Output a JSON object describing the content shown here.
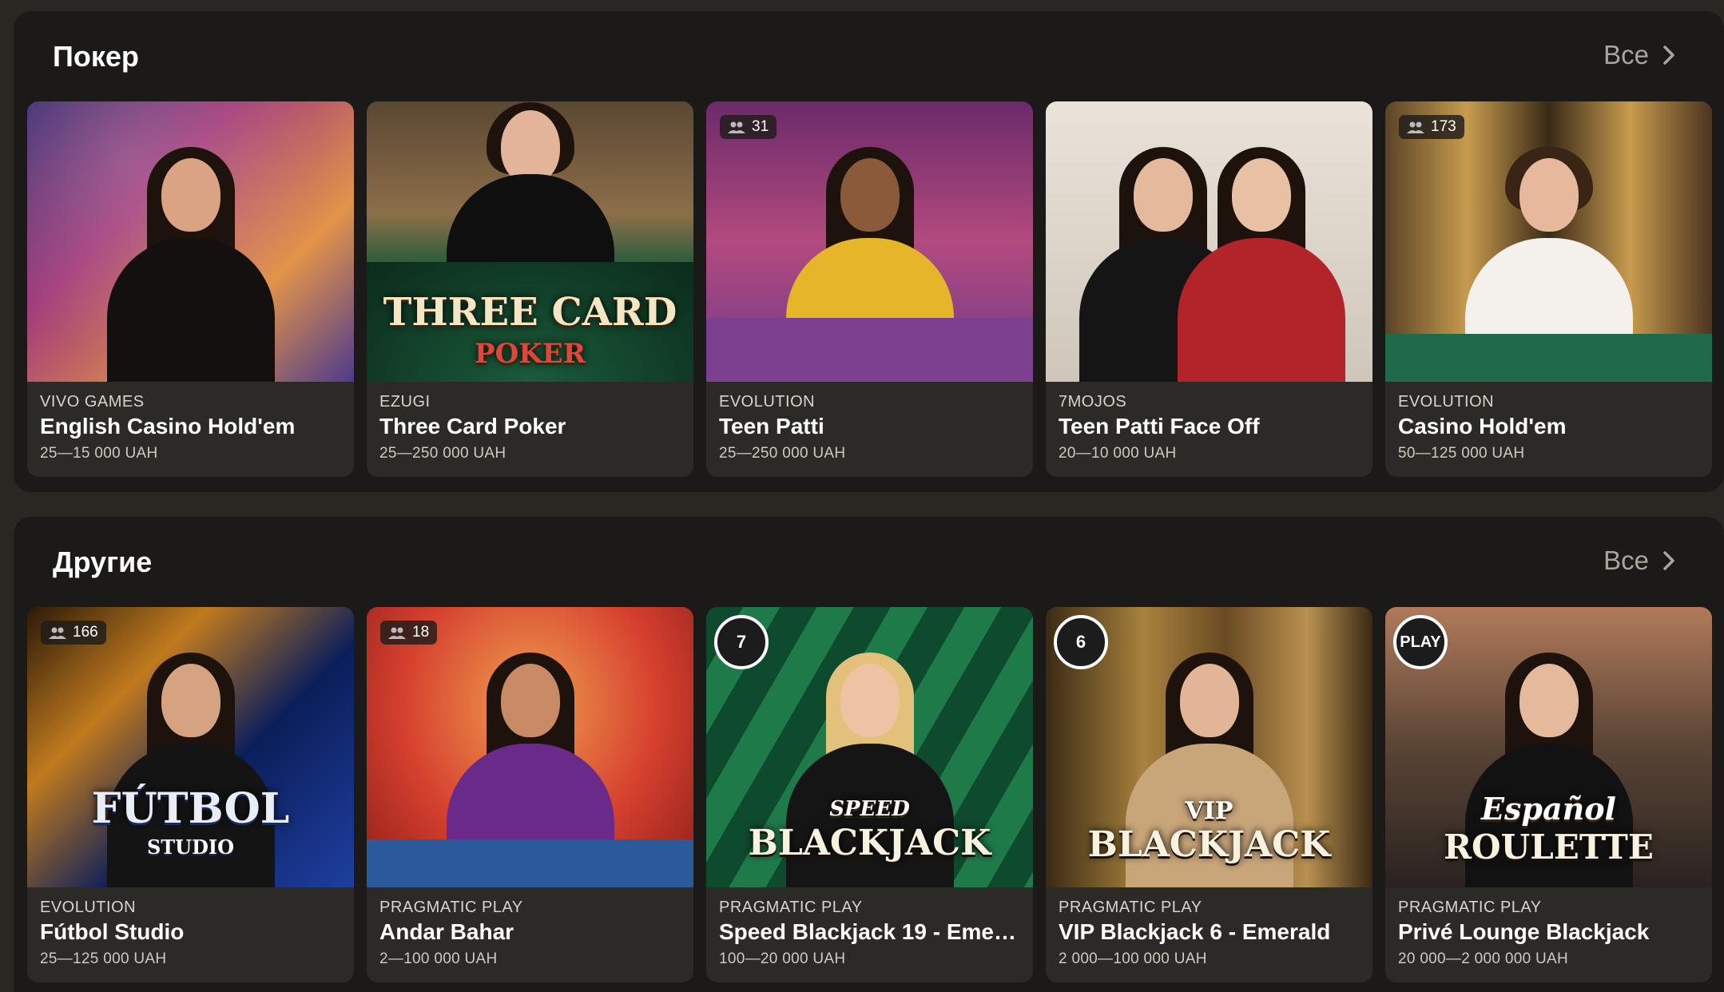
{
  "sections": [
    {
      "title": "Покер",
      "all_label": "Все",
      "cards": [
        {
          "provider": "VIVO GAMES",
          "name": "English Casino Hold'em",
          "limits": "25—15 000 UAH",
          "players": ""
        },
        {
          "provider": "EZUGI",
          "name": "Three Card Poker",
          "limits": "25—250 000 UAH",
          "players": "",
          "logo_line1": "THREE CARD",
          "logo_line2": "POKER"
        },
        {
          "provider": "EVOLUTION",
          "name": "Teen Patti",
          "limits": "25—250 000 UAH",
          "players": "31"
        },
        {
          "provider": "7MOJOS",
          "name": "Teen Patti Face Off",
          "limits": "20—10 000 UAH",
          "players": ""
        },
        {
          "provider": "EVOLUTION",
          "name": "Casino Hold'em",
          "limits": "50—125 000 UAH",
          "players": "173"
        }
      ]
    },
    {
      "title": "Другие",
      "all_label": "Все",
      "cards": [
        {
          "provider": "EVOLUTION",
          "name": "Fútbol Studio",
          "limits": "25—125 000 UAH",
          "players": "166",
          "logo_line1": "FÚTBOL",
          "logo_line2": "STUDIO"
        },
        {
          "provider": "PRAGMATIC PLAY",
          "name": "Andar Bahar",
          "limits": "2—100 000 UAH",
          "players": "18"
        },
        {
          "provider": "PRAGMATIC PLAY",
          "name": "Speed Blackjack 19 - Eme…",
          "limits": "100—20 000 UAH",
          "players": "7",
          "logo_line1": "SPEED",
          "logo_line2": "BLACKJACK"
        },
        {
          "provider": "PRAGMATIC PLAY",
          "name": "VIP Blackjack 6 - Emerald",
          "limits": "2 000—100 000 UAH",
          "players": "6",
          "logo_line1": "VIP",
          "logo_line2": "BLACKJACK"
        },
        {
          "provider": "PRAGMATIC PLAY",
          "name": "Privé Lounge Blackjack",
          "limits": "20 000—2 000 000 UAH",
          "players": "",
          "badge_text": "PLAY",
          "logo_line1": "Español",
          "logo_line2": "ROULETTE"
        }
      ]
    }
  ]
}
